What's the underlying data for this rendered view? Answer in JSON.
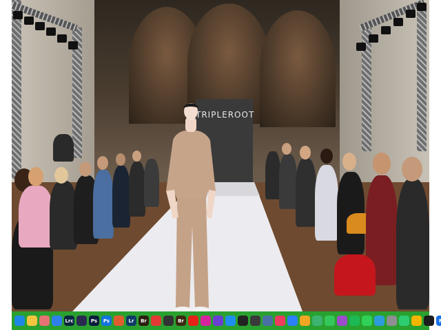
{
  "video": {
    "brand_text": "TRIPLEROOT"
  },
  "dock": {
    "apps": [
      {
        "name": "finder-icon",
        "label": "",
        "color": "#1e88e5"
      },
      {
        "name": "notes-icon",
        "label": "",
        "color": "#f5c542"
      },
      {
        "name": "photos-icon",
        "label": "",
        "color": "#e57373"
      },
      {
        "name": "safari-icon",
        "label": "",
        "color": "#2f80ed"
      },
      {
        "name": "lightroom-classic-icon",
        "label": "Lrc",
        "color": "#0c2740"
      },
      {
        "name": "bridge-arrow-icon",
        "label": "",
        "color": "#2b2b52"
      },
      {
        "name": "photoshop-icon",
        "label": "Ps",
        "color": "#0a1d3a"
      },
      {
        "name": "photoshop-beta-icon",
        "label": "Ps",
        "color": "#1273de"
      },
      {
        "name": "camera-raw-icon",
        "label": "",
        "color": "#e05d2f"
      },
      {
        "name": "lightroom-icon",
        "label": "Lr",
        "color": "#0f3b66"
      },
      {
        "name": "bridge-icon",
        "label": "Br",
        "color": "#2b1f0f"
      },
      {
        "name": "calendar-icon",
        "label": "",
        "color": "#e53935"
      },
      {
        "name": "camera-icon",
        "label": "",
        "color": "#333333"
      },
      {
        "name": "bridge-2-icon",
        "label": "Br",
        "color": "#3a2a12"
      },
      {
        "name": "youtube-icon",
        "label": "",
        "color": "#e62117"
      },
      {
        "name": "instagram-icon",
        "label": "",
        "color": "#d6249f"
      },
      {
        "name": "star-icon",
        "label": "",
        "color": "#6a3fd1"
      },
      {
        "name": "app-store-icon",
        "label": "",
        "color": "#1f8ef1"
      },
      {
        "name": "clapper-icon",
        "label": "",
        "color": "#222222"
      },
      {
        "name": "davinci-icon",
        "label": "",
        "color": "#3a3a3a"
      },
      {
        "name": "telescope-icon",
        "label": "",
        "color": "#4a6fa5"
      },
      {
        "name": "music-icon",
        "label": "",
        "color": "#f03a5f"
      },
      {
        "name": "keynote-icon",
        "label": "",
        "color": "#2d7ff9"
      },
      {
        "name": "pages-icon",
        "label": "",
        "color": "#f5a623"
      },
      {
        "name": "numbers-icon",
        "label": "",
        "color": "#3cb371"
      },
      {
        "name": "facetime-icon",
        "label": "",
        "color": "#34c759"
      },
      {
        "name": "podcasts-icon",
        "label": "",
        "color": "#9b4dca"
      },
      {
        "name": "spotify-icon",
        "label": "",
        "color": "#1db954"
      },
      {
        "name": "messages-icon",
        "label": "",
        "color": "#30d158"
      },
      {
        "name": "mail-icon",
        "label": "",
        "color": "#2d9cdb"
      },
      {
        "name": "system-settings-icon",
        "label": "",
        "color": "#8e8e93"
      },
      {
        "name": "activity-monitor-icon",
        "label": "",
        "color": "#2ecc71"
      },
      {
        "name": "sketch-icon",
        "label": "",
        "color": "#f7b500"
      },
      {
        "name": "terminal-icon",
        "label": "",
        "color": "#1c1c1c"
      },
      {
        "name": "malwarebytes-icon",
        "label": "M",
        "color": "#1a73e8"
      },
      {
        "name": "trash-icon",
        "label": "",
        "color": "#9aa0a6"
      }
    ]
  }
}
